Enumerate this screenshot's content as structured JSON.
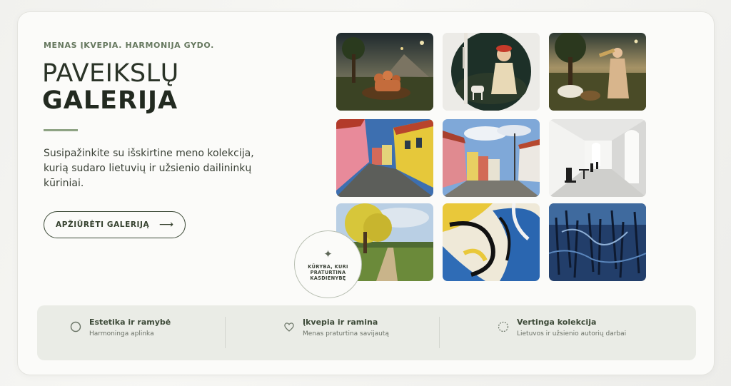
{
  "hero": {
    "eyebrow": "MENAS ĮKVEPIA. HARMONIJA GYDO.",
    "title_line1": "PAVEIKSLŲ",
    "title_line2": "GALERIJA",
    "description": "Susipažinkite su išskirtine meno kolekcija, kurią sudaro lietuvių ir užsienio dailininkų kūriniai.",
    "cta_label": "APŽIŪRĖTI GALERIJĄ",
    "cta_icon": "arrow-right-icon"
  },
  "badge": {
    "icon": "sparkle-icon",
    "text": "KŪRYBA, KURI PRATURTINA KASDIENYBĘ"
  },
  "gallery": {
    "paintings": [
      "night-landscape-figures-in-boat",
      "round-portrait-child-with-dog",
      "musician-with-animals-landscape",
      "colorful-old-town-street",
      "pastel-houses-street",
      "white-arched-corridor",
      "yellow-tree-field",
      "abstract-yellow-blue",
      "abstract-dark-blue"
    ]
  },
  "features": [
    {
      "icon": "circle-icon",
      "title": "Estetika ir ramybė",
      "subtitle": "Harmoninga aplinka"
    },
    {
      "icon": "heart-icon",
      "title": "Įkvepia ir ramina",
      "subtitle": "Menas praturtina savijautą"
    },
    {
      "icon": "dashed-circle-icon",
      "title": "Vertinga kolekcija",
      "subtitle": "Lietuvos ir užsienio autorių darbai"
    }
  ],
  "colors": {
    "accent": "#66785f",
    "dark": "#222a20",
    "panel": "#eaece6"
  }
}
